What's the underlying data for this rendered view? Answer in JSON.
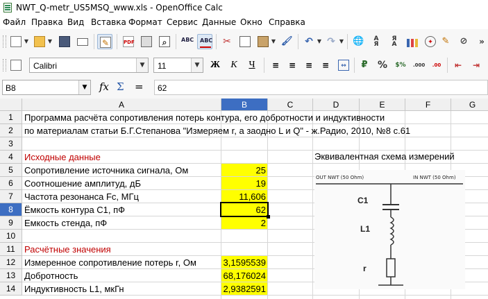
{
  "window": {
    "title": "NWT_Q-metr_US5MSQ_www.xls - OpenOffice Calc"
  },
  "menu": [
    "Файл",
    "Правка",
    "Вид",
    "Вставка",
    "Формат",
    "Сервис",
    "Данные",
    "Окно",
    "Справка"
  ],
  "toolbar_icons": [
    "new-icon",
    "open-icon",
    "save-icon",
    "email-icon",
    "edit-file-icon",
    "pdf-icon",
    "print-icon",
    "print-preview-icon",
    "spellcheck-icon",
    "autospellcheck-icon",
    "cut-icon",
    "copy-icon",
    "paste-icon",
    "format-paintbrush-icon",
    "undo-icon",
    "redo-icon",
    "hyperlink-icon",
    "sort-ascending-icon",
    "sort-descending-icon",
    "chart-icon",
    "navigator-icon",
    "draw-icon",
    "gallery-icon"
  ],
  "formatting": {
    "font_name": "Calibri",
    "font_size": "11",
    "bold_label": "Ж",
    "italic_label": "К",
    "underline_label": "Ч"
  },
  "formula_bar": {
    "cell_ref": "B8",
    "value": "62"
  },
  "columns": [
    "A",
    "B",
    "C",
    "D",
    "E",
    "F",
    "G"
  ],
  "selected_column": "B",
  "rows": [
    "1",
    "2",
    "3",
    "4",
    "5",
    "6",
    "7",
    "8",
    "9",
    "10",
    "11",
    "12",
    "13",
    "14"
  ],
  "selected_row": "8",
  "cells": {
    "A1": "Программа расчёта сопротивления потерь контура, его добротности и индуктивности",
    "A2": "по материалам статьи Б.Г.Степанова \"Измеряем r, а заодно L и Q\" - ж.Радио, 2010, №8 с.61",
    "A4": "Исходные данные",
    "A5": "Сопротивление источника сигнала, Ом",
    "A6": "Соотношение амплитуд, дБ",
    "A7": "Частота резонанса Fc, МГц",
    "A8": "Ёмкость контура  С1, пФ",
    "A9": "Емкость стенда, пФ",
    "A11": "Расчётные значения",
    "A12": "Измеренное сопротивление потерь r, Ом",
    "A13": "Добротность",
    "A14": "Индуктивность L1, мкГн",
    "B5": "25",
    "B6": "19",
    "B7": "11,606",
    "B8": "62",
    "B9": "2",
    "B12": "3,1595539",
    "B13": "68,176024",
    "B14": "2,9382591",
    "D4": "Эквивалентная схема  измерений"
  },
  "schematic": {
    "left_label": "OUT NWT (50 Ohm)",
    "right_label": "IN NWT (50 Ohm)",
    "c1": "C1",
    "l1": "L1",
    "r": "r"
  },
  "colors": {
    "yellow_fill": "#ffff00",
    "section_red": "#c00000",
    "selection_blue": "#3d6ec2"
  }
}
